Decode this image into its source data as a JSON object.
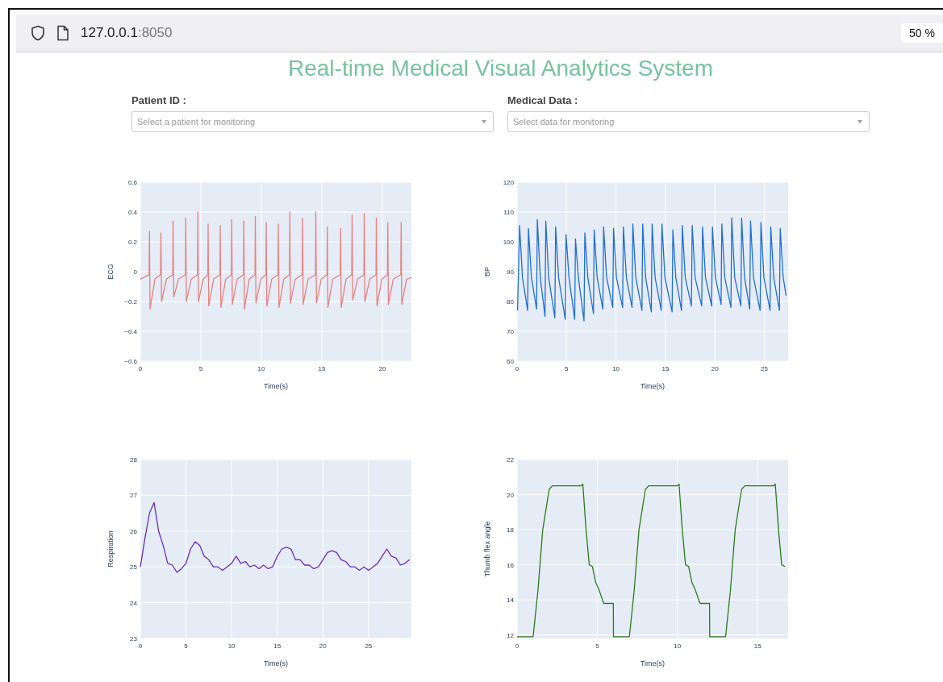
{
  "browser": {
    "url_host": "127.0.0.1",
    "url_port": ":8050",
    "zoom": "50 %"
  },
  "title": "Real-time Medical Visual Analytics System",
  "filters": [
    {
      "label": "Patient ID :",
      "placeholder": "Select a patient for monitoring"
    },
    {
      "label": "Medical Data :",
      "placeholder": "Select data for monitoring"
    }
  ],
  "charts": [
    {
      "chart_data": {
        "type": "line",
        "xlabel": "Time(s)",
        "ylabel": "ECG",
        "xlim": [
          0,
          22.4
        ],
        "ylim": [
          -0.6,
          0.6
        ],
        "xticks": [
          0,
          5,
          10,
          15,
          20
        ],
        "yticks": [
          {
            "value": -0.6,
            "label": "−0.6"
          },
          {
            "value": -0.4,
            "label": "−0.4"
          },
          {
            "value": -0.2,
            "label": "−0.2"
          },
          0,
          0.2,
          0.4,
          0.6
        ],
        "x": [
          0,
          0.72,
          0.75,
          0.8,
          1.2,
          1.67,
          1.7,
          1.75,
          2.15,
          2.67,
          2.7,
          2.75,
          3.15,
          3.72,
          3.75,
          3.8,
          4.2,
          4.72,
          4.75,
          4.8,
          5.2,
          5.57,
          5.6,
          5.65,
          6.05,
          6.57,
          6.6,
          6.65,
          7.05,
          7.52,
          7.55,
          7.6,
          8.0,
          8.52,
          8.55,
          8.6,
          9.0,
          9.47,
          9.5,
          9.55,
          9.95,
          10.37,
          10.4,
          10.45,
          10.85,
          11.37,
          11.4,
          11.45,
          11.85,
          12.32,
          12.35,
          12.4,
          12.8,
          13.37,
          13.4,
          13.45,
          13.85,
          14.47,
          14.5,
          14.55,
          14.95,
          15.42,
          15.45,
          15.5,
          15.9,
          16.52,
          16.55,
          16.6,
          17.0,
          17.47,
          17.5,
          17.55,
          17.95,
          18.47,
          18.5,
          18.55,
          18.95,
          19.47,
          19.5,
          19.55,
          19.95,
          20.42,
          20.45,
          20.5,
          20.9,
          21.52,
          21.55,
          21.6,
          22.0,
          22.4
        ],
        "grid": true,
        "series": [
          {
            "color": "#e88080",
            "values": [
              -0.05,
              -0.02,
              0.27,
              -0.25,
              -0.05,
              -0.02,
              0.26,
              -0.2,
              -0.05,
              -0.02,
              0.34,
              -0.17,
              -0.05,
              -0.02,
              0.36,
              -0.2,
              -0.05,
              -0.02,
              0.4,
              -0.2,
              -0.05,
              -0.02,
              0.32,
              -0.23,
              -0.05,
              -0.02,
              0.31,
              -0.24,
              -0.05,
              -0.02,
              0.35,
              -0.22,
              -0.05,
              -0.02,
              0.34,
              -0.25,
              -0.05,
              -0.02,
              0.37,
              -0.21,
              -0.05,
              -0.02,
              0.33,
              -0.23,
              -0.05,
              -0.02,
              0.32,
              -0.24,
              -0.05,
              -0.02,
              0.4,
              -0.21,
              -0.05,
              -0.02,
              0.36,
              -0.22,
              -0.05,
              -0.02,
              0.4,
              -0.21,
              -0.05,
              -0.02,
              0.3,
              -0.24,
              -0.05,
              -0.02,
              0.29,
              -0.24,
              -0.05,
              -0.02,
              0.38,
              -0.19,
              -0.05,
              -0.02,
              0.39,
              -0.2,
              -0.05,
              -0.02,
              0.36,
              -0.23,
              -0.05,
              -0.02,
              0.33,
              -0.22,
              -0.05,
              -0.02,
              0.33,
              -0.22,
              -0.05,
              -0.04
            ]
          }
        ]
      }
    },
    {
      "chart_data": {
        "type": "line",
        "xlabel": "Time(s)",
        "ylabel": "BP",
        "xlim": [
          0,
          27.4
        ],
        "ylim": [
          60,
          120
        ],
        "xticks": [
          0,
          5,
          10,
          15,
          20,
          25
        ],
        "yticks": [
          60,
          70,
          80,
          90,
          100,
          110,
          120
        ],
        "x": [
          0.05,
          0.25,
          0.55,
          1.07,
          1.15,
          1.45,
          1.97,
          2.05,
          2.35,
          2.82,
          2.9,
          3.2,
          3.82,
          3.9,
          4.2,
          4.87,
          4.95,
          5.25,
          5.82,
          5.9,
          6.2,
          6.77,
          6.85,
          7.15,
          7.72,
          7.8,
          8.1,
          8.67,
          8.75,
          9.05,
          9.67,
          9.75,
          10.05,
          10.67,
          10.75,
          11.05,
          11.62,
          11.7,
          12.0,
          12.62,
          12.7,
          13.0,
          13.57,
          13.65,
          13.95,
          14.57,
          14.65,
          14.95,
          15.67,
          15.75,
          16.05,
          16.62,
          16.7,
          17.0,
          17.62,
          17.7,
          18.0,
          18.67,
          18.75,
          19.05,
          19.67,
          19.75,
          20.05,
          20.62,
          20.7,
          21.0,
          21.62,
          21.7,
          22.0,
          22.62,
          22.7,
          23.0,
          23.52,
          23.6,
          23.9,
          24.57,
          24.65,
          24.95,
          25.57,
          25.65,
          25.95,
          26.52,
          26.6,
          26.9,
          27.2
        ],
        "grid": true,
        "series": [
          {
            "color": "#1f6fd1",
            "values": [
              77,
              105.5,
              88,
              77,
              104.5,
              88,
              77.5,
              107.5,
              88,
              75,
              107,
              88,
              74.5,
              105,
              88,
              74,
              102.5,
              88,
              74,
              101,
              88,
              73.5,
              103,
              88,
              76,
              104,
              88,
              77.5,
              105,
              88,
              78,
              104.5,
              88,
              78,
              105,
              88,
              78,
              106,
              88,
              77,
              106,
              88,
              76.5,
              106,
              88,
              77,
              106,
              88,
              76.5,
              104,
              88,
              77,
              105.5,
              88,
              78.5,
              105.5,
              88,
              78.5,
              105,
              88,
              78.5,
              105,
              88,
              79,
              106,
              88,
              78,
              108,
              88,
              78.5,
              108,
              88,
              77.5,
              107,
              88,
              77,
              106.5,
              88,
              77,
              105,
              88,
              77,
              104.5,
              88,
              82
            ]
          }
        ]
      }
    },
    {
      "chart_data": {
        "type": "line",
        "xlabel": "Time(s)",
        "ylabel": "Respiration",
        "xlim": [
          0,
          29.7
        ],
        "ylim": [
          23,
          28
        ],
        "xticks": [
          0,
          5,
          10,
          15,
          20,
          25
        ],
        "yticks": [
          23,
          24,
          25,
          26,
          27,
          28
        ],
        "x": [
          0,
          0.5,
          1,
          1.5,
          2,
          2.5,
          3,
          3.5,
          4,
          4.5,
          5,
          5.5,
          6,
          6.5,
          7,
          7.5,
          8,
          8.5,
          9,
          9.5,
          10,
          10.5,
          11,
          11.5,
          12,
          12.5,
          13,
          13.5,
          14,
          14.5,
          15,
          15.5,
          16,
          16.5,
          17,
          17.5,
          18,
          18.5,
          19,
          19.5,
          20,
          20.5,
          21,
          21.5,
          22,
          22.5,
          23,
          23.5,
          24,
          24.5,
          25,
          25.5,
          26,
          26.5,
          27,
          27.5,
          28,
          28.5,
          29,
          29.5
        ],
        "grid": true,
        "series": [
          {
            "color": "#6a2cc0",
            "values": [
              25.0,
              25.8,
              26.5,
              26.8,
              26.0,
              25.6,
              25.1,
              25.05,
              24.85,
              24.95,
              25.1,
              25.5,
              25.7,
              25.6,
              25.3,
              25.2,
              25.0,
              25.0,
              24.9,
              25.0,
              25.1,
              25.3,
              25.1,
              25.15,
              25.0,
              25.05,
              24.95,
              25.05,
              24.95,
              25.0,
              25.3,
              25.5,
              25.55,
              25.5,
              25.2,
              25.2,
              25.05,
              25.05,
              24.95,
              25.0,
              25.2,
              25.4,
              25.45,
              25.4,
              25.2,
              25.15,
              25.0,
              25.0,
              24.9,
              25.0,
              24.9,
              25.0,
              25.1,
              25.3,
              25.5,
              25.3,
              25.25,
              25.05,
              25.1,
              25.2
            ]
          }
        ]
      }
    },
    {
      "chart_data": {
        "type": "line",
        "xlabel": "Time(s)",
        "ylabel": "Thumb flex angle",
        "xlim": [
          0,
          16.9
        ],
        "ylim": [
          11.8,
          22
        ],
        "xticks": [
          0,
          5,
          10,
          15
        ],
        "yticks": [
          12,
          14,
          16,
          18,
          20,
          22
        ],
        "x": [
          0,
          1,
          1.3,
          1.6,
          2,
          2.2,
          4,
          4.1,
          4.3,
          4.5,
          4.7,
          4.9,
          5.1,
          5.4,
          6,
          6.01,
          7,
          7.3,
          7.6,
          8,
          8.2,
          10,
          10.1,
          10.3,
          10.5,
          10.7,
          10.9,
          11.1,
          11.4,
          12,
          12.01,
          13,
          13.3,
          13.6,
          14,
          14.2,
          16,
          16.1,
          16.3,
          16.5,
          16.7
        ],
        "grid": true,
        "series": [
          {
            "color": "#2d7a1a",
            "values": [
              11.9,
              11.9,
              14.5,
              18,
              20.3,
              20.5,
              20.5,
              20.6,
              18,
              16,
              15.9,
              15,
              14.6,
              13.8,
              13.8,
              11.9,
              11.9,
              14.5,
              18,
              20.3,
              20.5,
              20.5,
              20.6,
              18,
              16,
              15.9,
              15,
              14.6,
              13.8,
              13.8,
              11.9,
              11.9,
              14.5,
              18,
              20.3,
              20.5,
              20.5,
              20.6,
              18,
              16,
              15.9
            ]
          }
        ]
      }
    }
  ]
}
